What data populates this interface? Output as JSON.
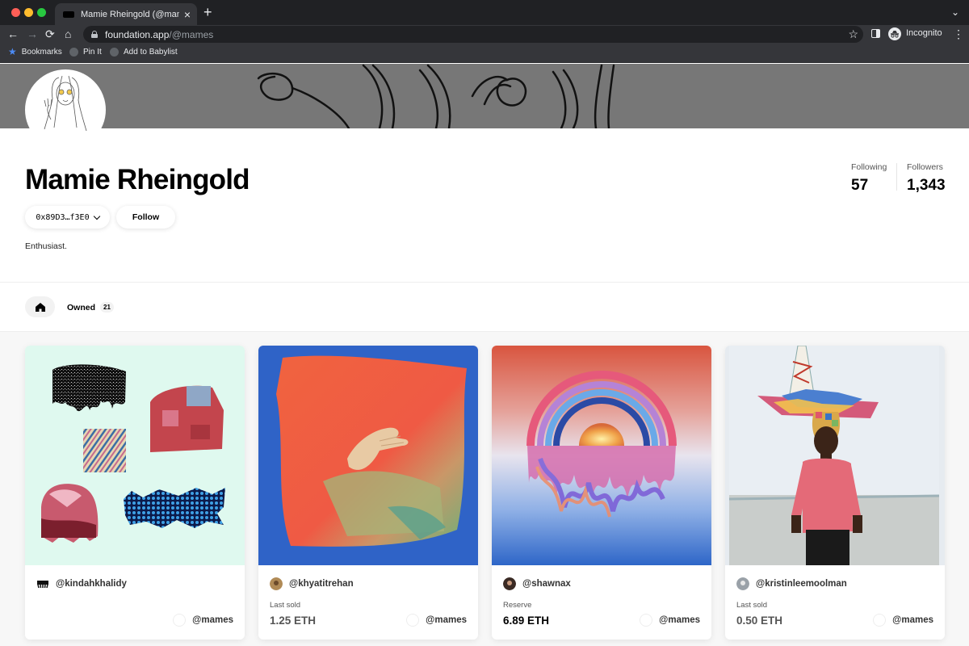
{
  "browser": {
    "tab_title": "Mamie Rheingold (@mames) | F",
    "url_host": "foundation.app",
    "url_path": "/@mames",
    "incognito_label": "Incognito",
    "bookmarks": [
      {
        "label": "Bookmarks"
      },
      {
        "label": "Pin It"
      },
      {
        "label": "Add to Babylist"
      }
    ]
  },
  "profile": {
    "name": "Mamie Rheingold",
    "wallet_address": "0x89D3…f3E0",
    "follow_label": "Follow",
    "bio": "Enthusiast.",
    "following_label": "Following",
    "following_count": "57",
    "followers_label": "Followers",
    "followers_count": "1,343"
  },
  "tabs": {
    "owned_label": "Owned",
    "owned_count": "21"
  },
  "cards": [
    {
      "creator": "@kindahkhalidy",
      "price_label": "",
      "price": "",
      "owner": "@mames"
    },
    {
      "creator": "@khyatitrehan",
      "price_label": "Last sold",
      "price": "1.25 ETH",
      "owner": "@mames"
    },
    {
      "creator": "@shawnax",
      "price_label": "Reserve",
      "price": "6.89 ETH",
      "owner": "@mames"
    },
    {
      "creator": "@kristinleemoolman",
      "price_label": "Last sold",
      "price": "0.50 ETH",
      "owner": "@mames"
    }
  ],
  "colors": {
    "cover": "#777777",
    "card1_bg": "#dff9ef",
    "card2_bg": "#2f63c7",
    "card3_sky": "#d9553f",
    "card4_bg": "#e6ebf0"
  }
}
